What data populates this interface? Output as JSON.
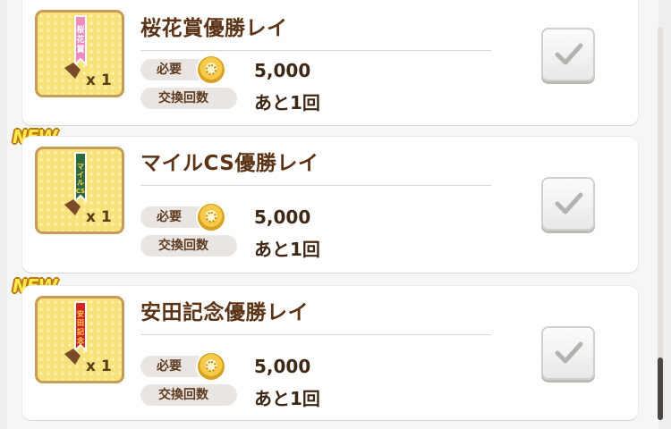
{
  "items": [
    {
      "title": "桜花賞優勝レイ",
      "is_new": false,
      "new_label": "",
      "quantity": "x 1",
      "cost_label": "必要",
      "cost_value": "5,000",
      "exchange_label": "交換回数",
      "exchange_value": "あと1回",
      "sash_color": "#f08bc0",
      "sash_text": "桜花賞"
    },
    {
      "title": "マイルCS優勝レイ",
      "is_new": true,
      "new_label": "NEW",
      "quantity": "x 1",
      "cost_label": "必要",
      "cost_value": "5,000",
      "exchange_label": "交換回数",
      "exchange_value": "あと1回",
      "sash_color": "#2f6a41",
      "sash_text": "マイルCS"
    },
    {
      "title": "安田記念優勝レイ",
      "is_new": true,
      "new_label": "NEW",
      "quantity": "x 1",
      "cost_label": "必要",
      "cost_value": "5,000",
      "exchange_label": "交換回数",
      "exchange_value": "あと1回",
      "sash_color": "#d42424",
      "sash_text": "安田記念"
    }
  ],
  "icons": {
    "coin": "coin-icon",
    "check": "check-icon",
    "sash": "victory-sash-icon"
  },
  "colors": {
    "title_text": "#5b3416",
    "new_badge": "#ffe94a",
    "item_frame": "#c79b58"
  }
}
